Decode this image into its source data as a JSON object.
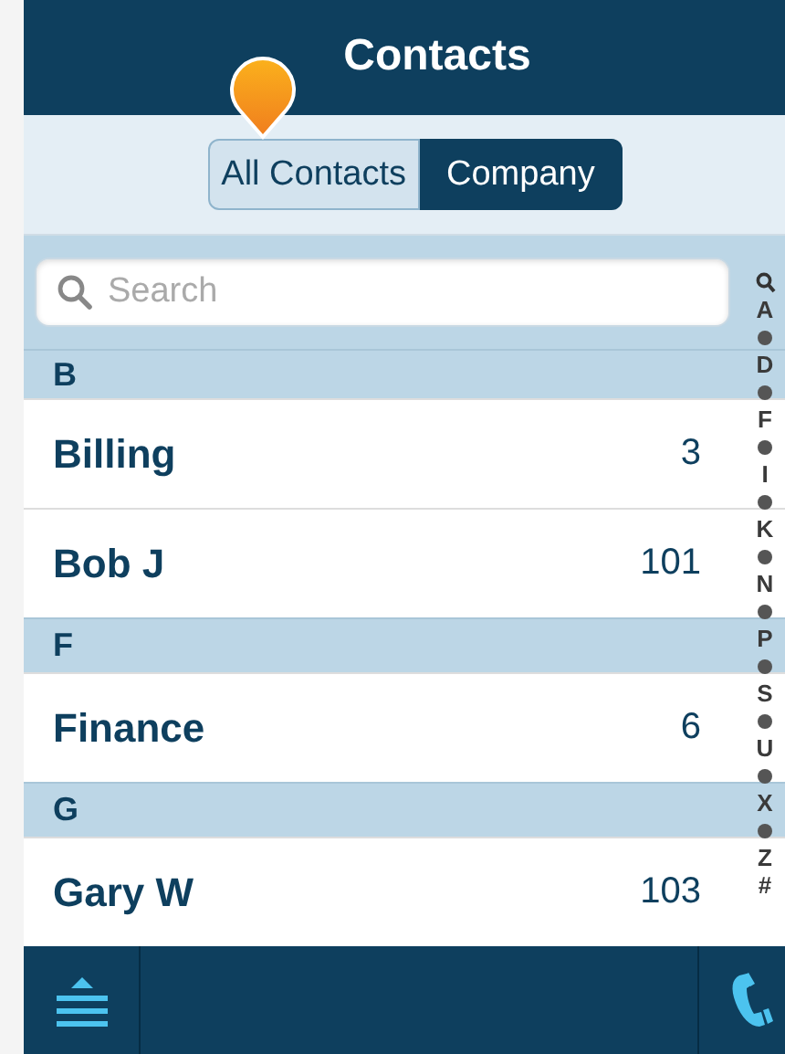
{
  "header": {
    "title": "Contacts"
  },
  "tabs": [
    {
      "label": "All Contacts",
      "selected": false
    },
    {
      "label": "Company",
      "selected": true
    }
  ],
  "search": {
    "placeholder": "Search"
  },
  "sections": [
    {
      "letter": "B",
      "contacts": [
        {
          "name": "Billing",
          "count": "3"
        },
        {
          "name": "Bob J",
          "count": "101"
        }
      ]
    },
    {
      "letter": "F",
      "contacts": [
        {
          "name": "Finance",
          "count": "6"
        }
      ]
    },
    {
      "letter": "G",
      "contacts": [
        {
          "name": "Gary W",
          "count": "103"
        }
      ]
    }
  ],
  "index": [
    {
      "kind": "search"
    },
    {
      "kind": "letter",
      "text": "A"
    },
    {
      "kind": "dot"
    },
    {
      "kind": "letter",
      "text": "D"
    },
    {
      "kind": "dot"
    },
    {
      "kind": "letter",
      "text": "F"
    },
    {
      "kind": "dot"
    },
    {
      "kind": "letter",
      "text": "I"
    },
    {
      "kind": "dot"
    },
    {
      "kind": "letter",
      "text": "K"
    },
    {
      "kind": "dot"
    },
    {
      "kind": "letter",
      "text": "N"
    },
    {
      "kind": "dot"
    },
    {
      "kind": "letter",
      "text": "P"
    },
    {
      "kind": "dot"
    },
    {
      "kind": "letter",
      "text": "S"
    },
    {
      "kind": "dot"
    },
    {
      "kind": "letter",
      "text": "U"
    },
    {
      "kind": "dot"
    },
    {
      "kind": "letter",
      "text": "X"
    },
    {
      "kind": "dot"
    },
    {
      "kind": "letter",
      "text": "Z"
    },
    {
      "kind": "letter",
      "text": "#"
    }
  ]
}
